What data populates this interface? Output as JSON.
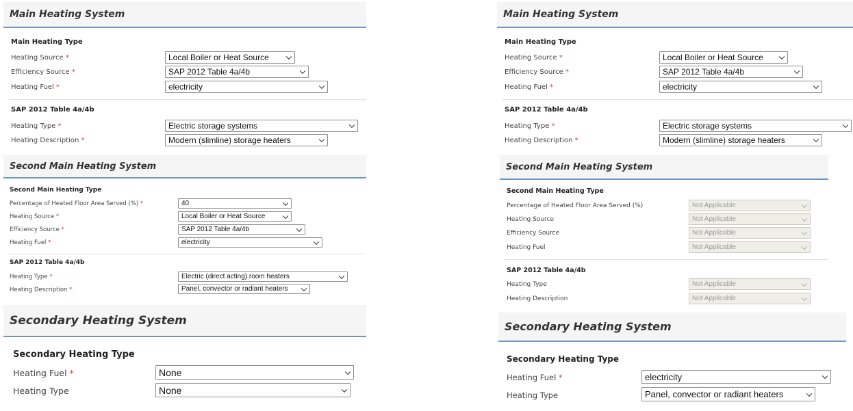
{
  "left": {
    "main": {
      "title": "Main Heating System",
      "type_heading": "Main Heating Type",
      "heating_source_label": "Heating Source",
      "heating_source_value": "Local Boiler or Heat Source",
      "efficiency_source_label": "Efficiency Source",
      "efficiency_source_value": "SAP 2012 Table 4a/4b",
      "heating_fuel_label": "Heating Fuel",
      "heating_fuel_value": "electricity",
      "table_heading": "SAP 2012 Table 4a/4b",
      "heating_type_label": "Heating Type",
      "heating_type_value": "Electric storage systems",
      "heating_description_label": "Heating Description",
      "heating_description_value": "Modern (slimline) storage heaters"
    },
    "second": {
      "title": "Second Main Heating System",
      "type_heading": "Second Main Heating Type",
      "percentage_label": "Percentage of Heated Floor Area Served (%)",
      "percentage_value": "40",
      "heating_source_label": "Heating Source",
      "heating_source_value": "Local Boiler or Heat Source",
      "efficiency_source_label": "Efficiency Source",
      "efficiency_source_value": "SAP 2012 Table 4a/4b",
      "heating_fuel_label": "Heating Fuel",
      "heating_fuel_value": "electricity",
      "table_heading": "SAP 2012 Table 4a/4b",
      "heating_type_label": "Heating Type",
      "heating_type_value": "Electric (direct acting) room heaters",
      "heating_description_label": "Heating Description",
      "heating_description_value": "Panel, convector or radiant heaters"
    },
    "secondary": {
      "title": "Secondary Heating System",
      "type_heading": "Secondary Heating Type",
      "heating_fuel_label": "Heating Fuel",
      "heating_fuel_value": "None",
      "heating_type_label": "Heating Type",
      "heating_type_value": "None"
    }
  },
  "right": {
    "main": {
      "title": "Main Heating System",
      "type_heading": "Main Heating Type",
      "heating_source_label": "Heating Source",
      "heating_source_value": "Local Boiler or Heat Source",
      "efficiency_source_label": "Efficiency Source",
      "efficiency_source_value": "SAP 2012 Table 4a/4b",
      "heating_fuel_label": "Heating Fuel",
      "heating_fuel_value": "electricity",
      "table_heading": "SAP 2012 Table 4a/4b",
      "heating_type_label": "Heating Type",
      "heating_type_value": "Electric storage systems",
      "heating_description_label": "Heating Description",
      "heating_description_value": "Modern (slimline) storage heaters"
    },
    "second": {
      "title": "Second Main Heating System",
      "type_heading": "Second Main Heating Type",
      "percentage_label": "Percentage of Heated Floor Area Served (%)",
      "percentage_value": "Not Applicable",
      "heating_source_label": "Heating Source",
      "heating_source_value": "Not Applicable",
      "efficiency_source_label": "Efficiency Source",
      "efficiency_source_value": "Not Applicable",
      "heating_fuel_label": "Heating Fuel",
      "heating_fuel_value": "Not Applicable",
      "table_heading": "SAP 2012 Table 4a/4b",
      "heating_type_label": "Heating Type",
      "heating_type_value": "Not Applicable",
      "heating_description_label": "Heating Description",
      "heating_description_value": "Not Applicable"
    },
    "secondary": {
      "title": "Secondary Heating System",
      "type_heading": "Secondary Heating Type",
      "heating_fuel_label": "Heating Fuel",
      "heating_fuel_value": "electricity",
      "heating_type_label": "Heating Type",
      "heating_type_value": "Panel, convector or radiant heaters"
    }
  },
  "required_marker": "*",
  "colors": {
    "header_rule": "#6f95bf",
    "required": "#d9383a",
    "disabled_bg": "#efefe8"
  }
}
